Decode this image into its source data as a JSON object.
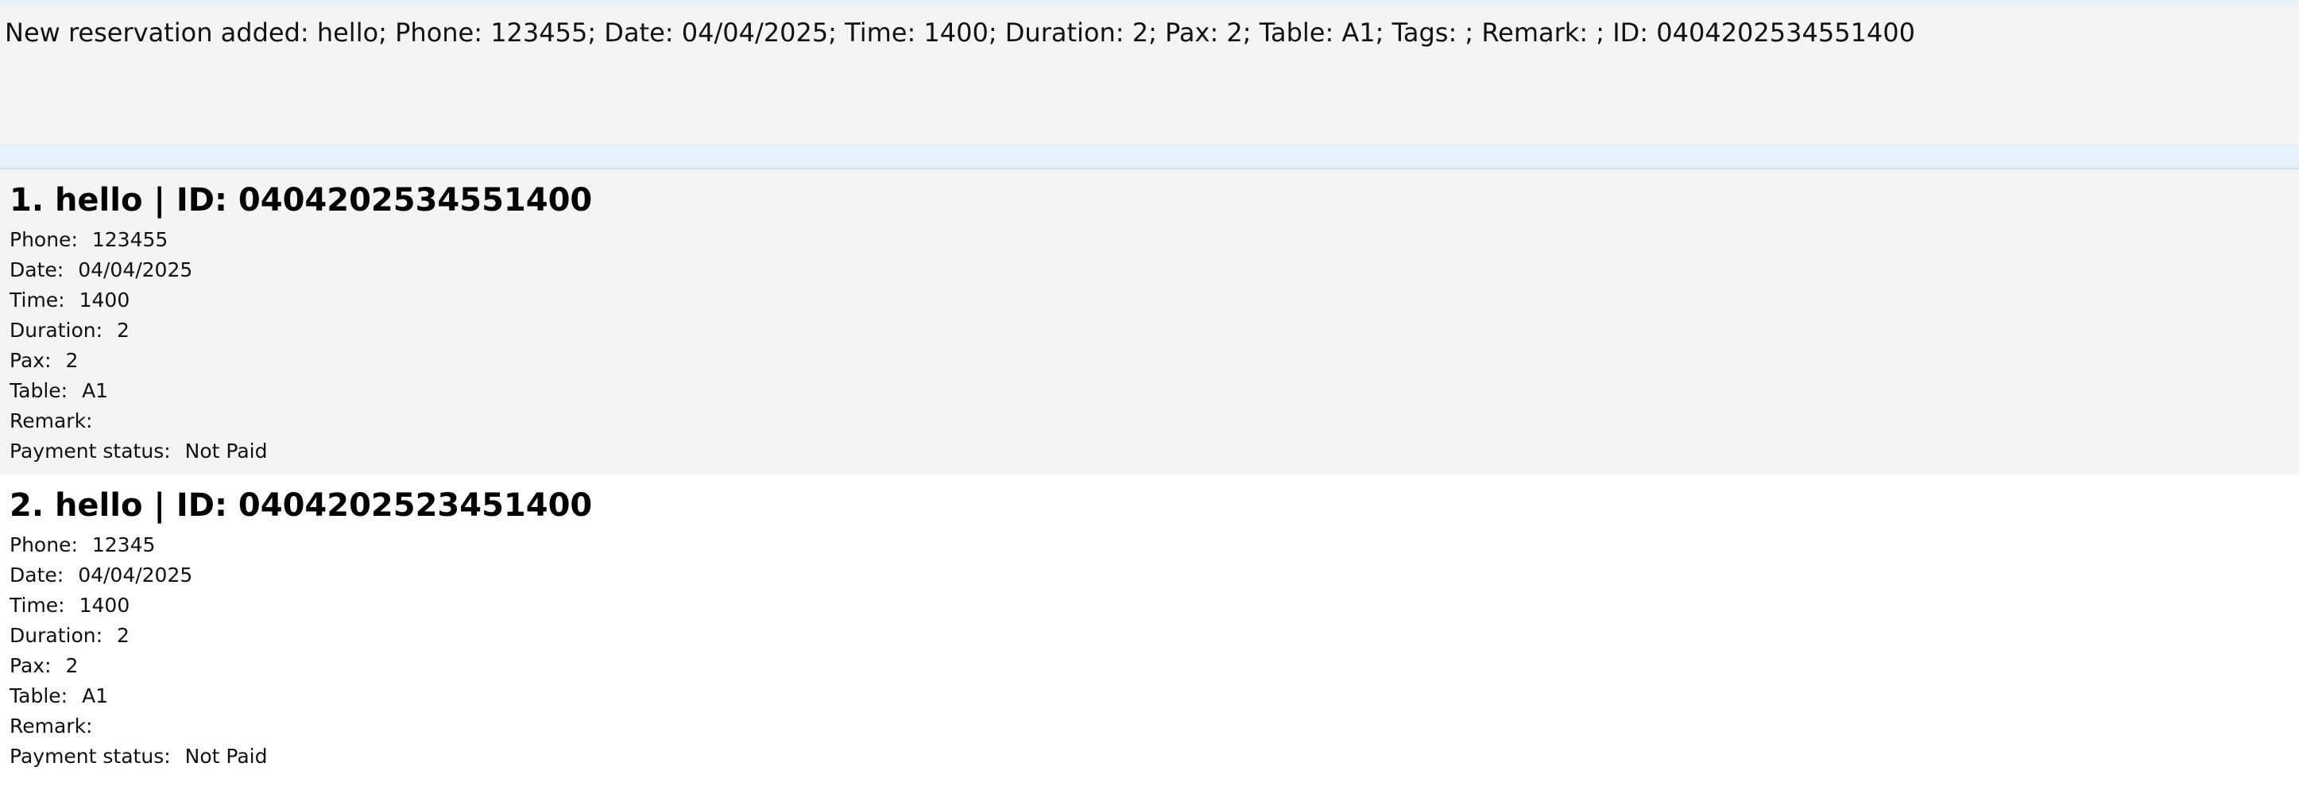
{
  "result_message": "New reservation added: hello; Phone: 123455; Date: 04/04/2025; Time: 1400; Duration: 2; Pax: 2; Table: A1; Tags: ; Remark: ; ID: 0404202534551400",
  "labels": {
    "phone": "Phone:",
    "date": "Date:",
    "time": "Time:",
    "duration": "Duration:",
    "pax": "Pax:",
    "table": "Table:",
    "remark": "Remark:",
    "payment": "Payment status:"
  },
  "reservations": [
    {
      "title": "1. hello | ID: 0404202534551400",
      "phone": "123455",
      "date": "04/04/2025",
      "time": "1400",
      "duration": "2",
      "pax": "2",
      "table": "A1",
      "remark": "",
      "payment": "Not Paid"
    },
    {
      "title": "2. hello | ID: 0404202523451400",
      "phone": "12345",
      "date": "04/04/2025",
      "time": "1400",
      "duration": "2",
      "pax": "2",
      "table": "A1",
      "remark": "",
      "payment": "Not Paid"
    }
  ],
  "colors": {
    "panel_background": "#f4f4f4",
    "accent_strip": "#e6f2fb"
  }
}
